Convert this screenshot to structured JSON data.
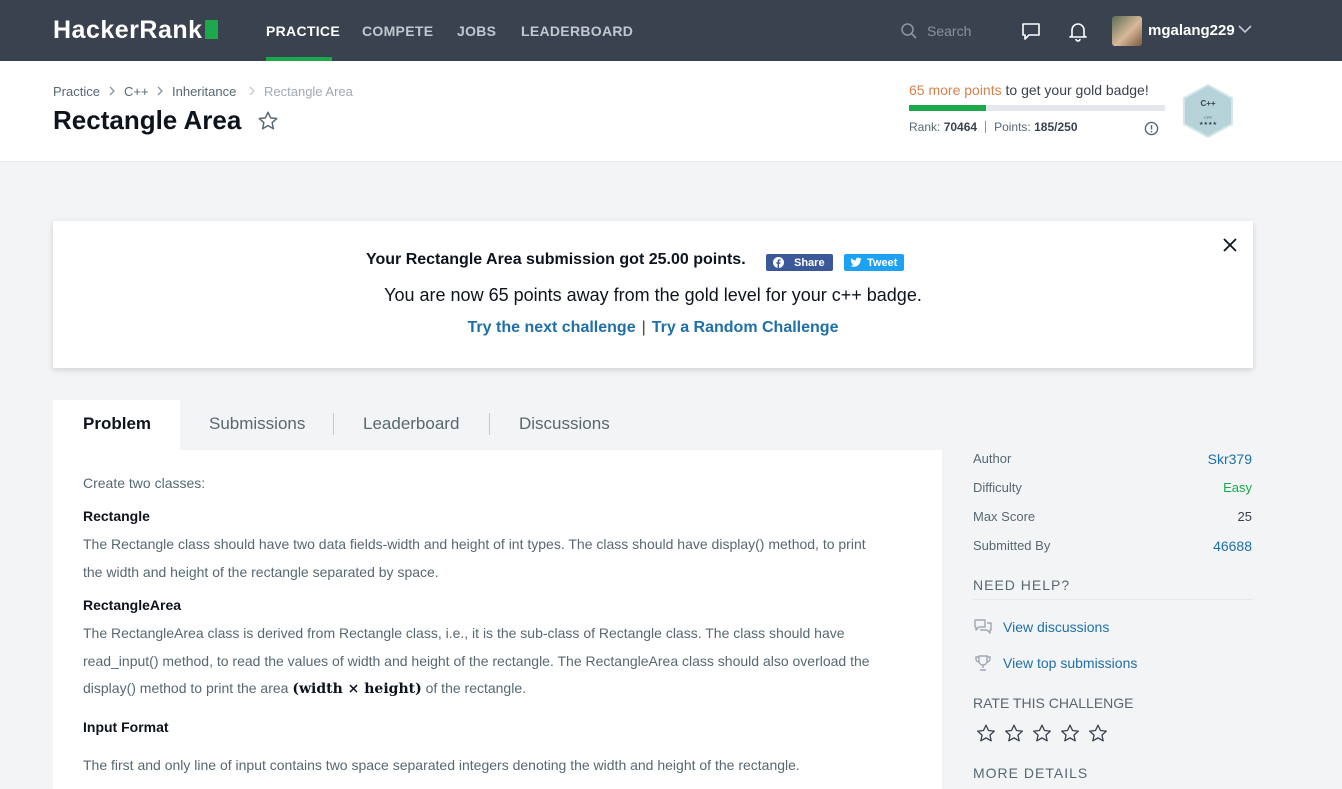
{
  "nav": {
    "logo_text": "HackerRank",
    "links": [
      "PRACTICE",
      "COMPETE",
      "JOBS",
      "LEADERBOARD"
    ],
    "active_link": "PRACTICE",
    "search_placeholder": "Search",
    "username": "mgalang229",
    "accent_color": "#1ba94c"
  },
  "breadcrumb": [
    "Practice",
    "C++",
    "Inheritance",
    "Rectangle Area"
  ],
  "page_title": "Rectangle Area",
  "badge_status": {
    "points_text": "65 more points",
    "rest_text": " to get your gold badge!",
    "progress_fraction": 0.3,
    "rank_label": "Rank:",
    "rank_value": "70464",
    "points_label": "Points:",
    "points_value": "185/250",
    "badge_text": "C++",
    "badge_sub": "CPP"
  },
  "banner": {
    "message": "Your Rectangle Area submission got 25.00 points.",
    "share_label": "Share",
    "tweet_label": "Tweet",
    "gold_message": "You are now 65 points away from the gold level for your c++ badge.",
    "next_link": "Try the next challenge",
    "separator": "|",
    "random_link": "Try a Random Challenge"
  },
  "tabs": [
    "Problem",
    "Submissions",
    "Leaderboard",
    "Discussions"
  ],
  "problem": {
    "intro": "Create two classes:",
    "rect_heading": "Rectangle",
    "rect_line1": "The Rectangle class should have two data fields-width and height of int types. The class should have display() method, to print",
    "rect_line2": "the width and height of the rectangle separated by space.",
    "area_heading": "RectangleArea",
    "area_line1": "The RectangleArea class is derived from Rectangle class, i.e., it is the sub-class of Rectangle class. The class should have",
    "area_line2": "read_input() method, to read the values of width and height of the rectangle. The RectangleArea class should also overload the",
    "area_line3_pre": "display() method to print the area",
    "area_line3_math": "(width × height)",
    "area_line3_post": "of the rectangle.",
    "input_heading": "Input Format",
    "input_text": "The first and only line of input contains two space separated integers denoting the width and height of the rectangle."
  },
  "sidebar": {
    "details": [
      {
        "label": "Author",
        "value": "Skr379"
      },
      {
        "label": "Difficulty",
        "value": "Easy"
      },
      {
        "label": "Max Score",
        "value": "25"
      },
      {
        "label": "Submitted By",
        "value": "46688"
      }
    ],
    "need_help": "NEED HELP?",
    "view_discussions": "View discussions",
    "view_top_submissions": "View top submissions",
    "rate_heading": "RATE THIS CHALLENGE",
    "more_details": "MORE DETAILS",
    "difficulty_color": "#1ba94c",
    "link_color": "#1f6fa8"
  }
}
